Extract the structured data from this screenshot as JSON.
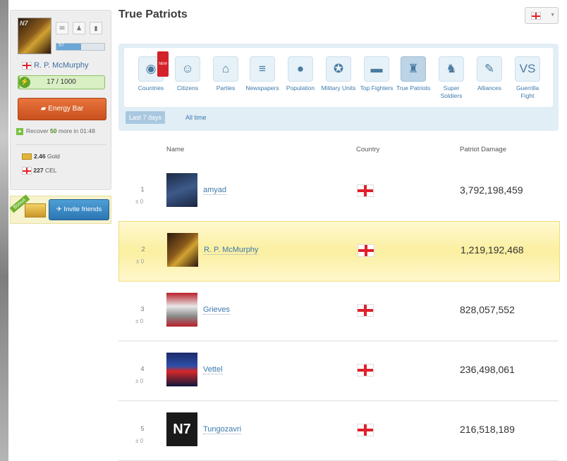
{
  "page": {
    "title": "True Patriots"
  },
  "sidebar": {
    "username": "R. P. McMurphy",
    "xp_label": "57",
    "energy": "17 / 1000",
    "energy_button": "Energy Bar",
    "recover_prefix": "Recover",
    "recover_amount": "50",
    "recover_suffix": "more in 01:48",
    "gold_amount": "2.46",
    "gold_label": "Gold",
    "cel_amount": "227",
    "cel_label": "CEL",
    "bonus_label": "Bonus",
    "invite_label": "Invite friends"
  },
  "categories": [
    {
      "label": "Countries",
      "icon": "globe-icon",
      "new": "NEW"
    },
    {
      "label": "Citizens",
      "icon": "citizens-icon"
    },
    {
      "label": "Parties",
      "icon": "parties-icon"
    },
    {
      "label": "Newspapers",
      "icon": "newspaper-icon"
    },
    {
      "label": "Population",
      "icon": "population-icon"
    },
    {
      "label": "Military Units",
      "icon": "military-units-icon"
    },
    {
      "label": "Top Fighters",
      "icon": "tank-icon"
    },
    {
      "label": "True Patriots",
      "icon": "patriots-icon"
    },
    {
      "label": "Super",
      "label2": "Soldiers",
      "icon": "soldier-icon"
    },
    {
      "label": "Alliances",
      "icon": "alliances-icon"
    },
    {
      "label": "Guerrilla",
      "label2": "Fight",
      "icon": "guerrilla-icon"
    }
  ],
  "periods": {
    "selected": "Last 7 days",
    "other": "All time"
  },
  "table": {
    "headers": {
      "name": "Name",
      "country": "Country",
      "damage": "Patriot Damage"
    },
    "rows": [
      {
        "rank": "1",
        "change": "± 0",
        "name": "amyad",
        "damage": "3,792,198,459"
      },
      {
        "rank": "2",
        "change": "± 0",
        "name": "R. P. McMurphy",
        "damage": "1,219,192,468"
      },
      {
        "rank": "3",
        "change": "± 0",
        "name": "Grieves",
        "damage": "828,057,552"
      },
      {
        "rank": "4",
        "change": "± 0",
        "name": "Vettel",
        "damage": "236,498,061"
      },
      {
        "rank": "5",
        "change": "± 0",
        "name": "Tungozavri",
        "damage": "216,518,189"
      }
    ]
  },
  "colors": {
    "accent": "#3b79ad",
    "highlight": "#fbefa0",
    "energy": "#7ac142",
    "energy_button": "#d9602a"
  }
}
